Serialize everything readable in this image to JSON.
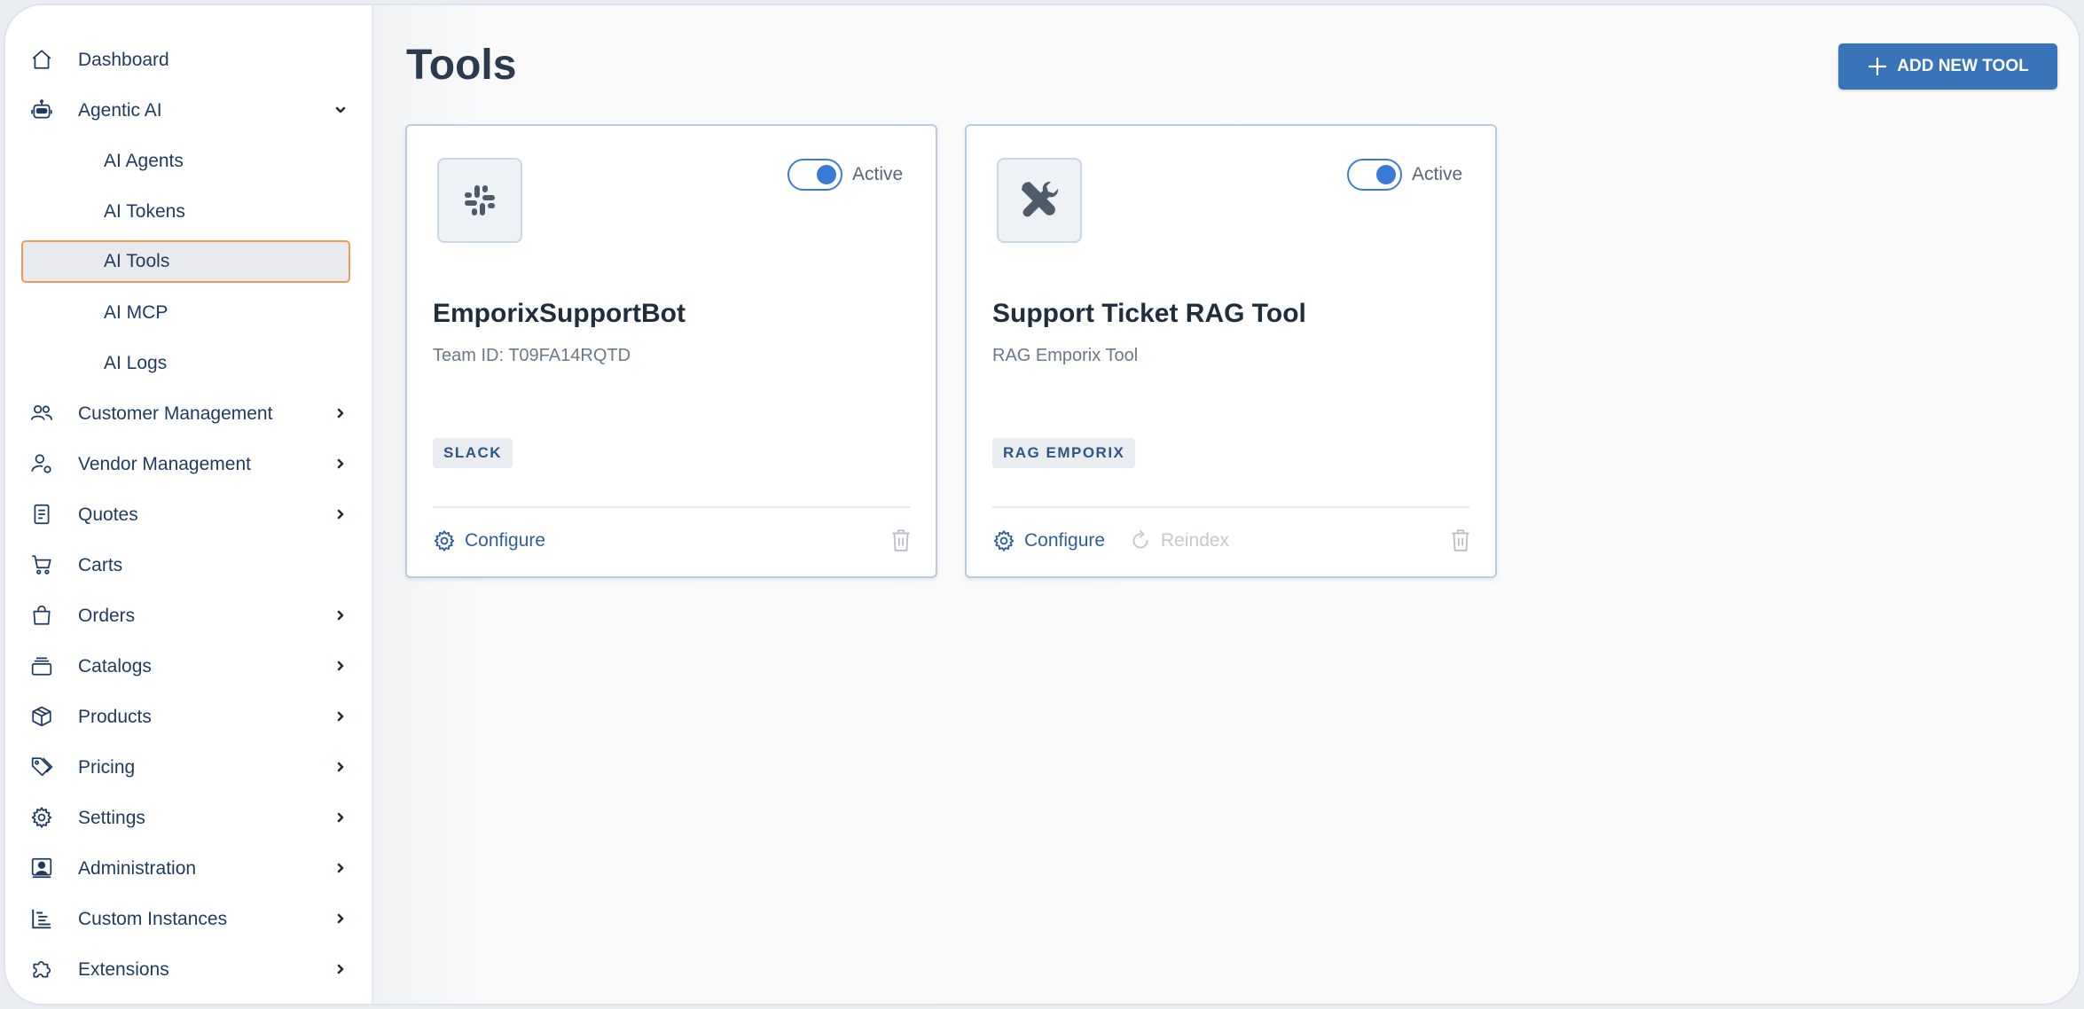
{
  "sidebar": {
    "dashboard": "Dashboard",
    "agentic_ai": "Agentic AI",
    "agentic_sub": [
      "AI Agents",
      "AI Tokens",
      "AI Tools",
      "AI MCP",
      "AI Logs"
    ],
    "customer_management": "Customer Management",
    "vendor_management": "Vendor Management",
    "quotes": "Quotes",
    "carts": "Carts",
    "orders": "Orders",
    "catalogs": "Catalogs",
    "products": "Products",
    "pricing": "Pricing",
    "settings": "Settings",
    "administration": "Administration",
    "custom_instances": "Custom Instances",
    "extensions": "Extensions"
  },
  "header": {
    "title": "Tools",
    "add_button": "ADD NEW TOOL"
  },
  "cards": [
    {
      "icon": "slack-icon",
      "status": "Active",
      "active": true,
      "title": "EmporixSupportBot",
      "subtitle": "Team ID: T09FA14RQTD",
      "tag": "SLACK",
      "configure": "Configure"
    },
    {
      "icon": "tools-icon",
      "status": "Active",
      "active": true,
      "title": "Support Ticket RAG Tool",
      "subtitle": "RAG Emporix Tool",
      "tag": "RAG EMPORIX",
      "configure": "Configure",
      "reindex": "Reindex"
    }
  ],
  "colors": {
    "accent": "#3a74b8",
    "nav_text": "#1f3a5f",
    "active_border": "#ec9b58",
    "toggle": "#3b7bd8"
  }
}
